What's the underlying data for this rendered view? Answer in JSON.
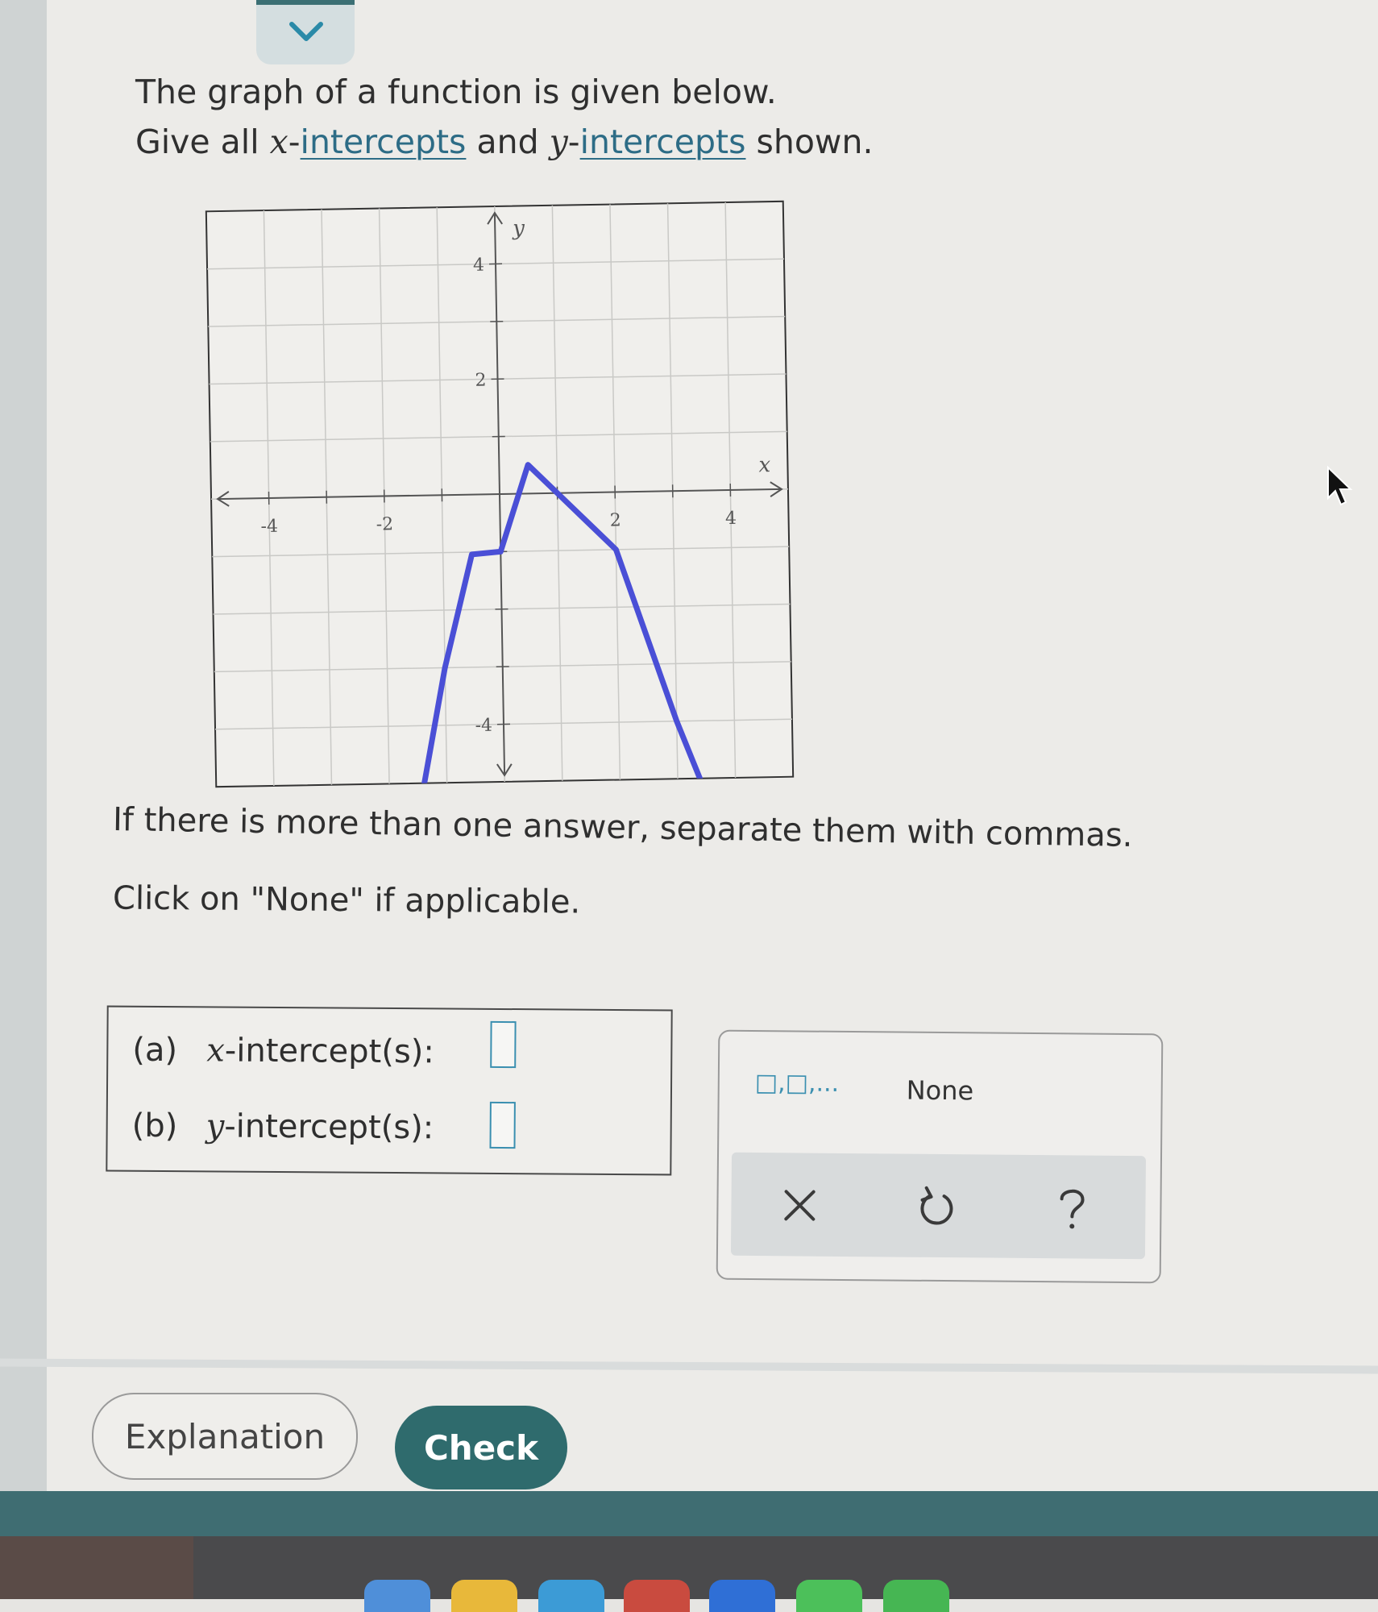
{
  "question": {
    "line1": "The graph of a function is given below.",
    "line2_prefix": "Give all ",
    "x_var": "x",
    "line2_dash1": "-",
    "x_link": "intercepts",
    "line2_mid": " and ",
    "y_var": "y",
    "line2_dash2": "-",
    "y_link": "intercepts",
    "line2_suffix": " shown."
  },
  "chart_data": {
    "type": "line",
    "title": "",
    "xlabel": "x",
    "ylabel": "y",
    "xlim": [
      -5,
      5
    ],
    "ylim": [
      -5,
      5
    ],
    "grid": true,
    "x_ticks": [
      -4,
      -2,
      2,
      4
    ],
    "y_ticks": [
      -4,
      2,
      4
    ],
    "x_tick_labels": [
      "-4",
      "-2",
      "2",
      "4"
    ],
    "y_tick_labels": [
      "-4",
      "2",
      "4"
    ],
    "series": [
      {
        "x": [
          -1.4,
          -1,
          -0.5,
          0,
          0.5,
          1,
          1.5,
          2,
          2.5,
          3,
          3.4
        ],
        "y": [
          -5.04,
          -3.0,
          -1.04,
          -1.0,
          0.5,
          0.0,
          -0.5,
          -1.0,
          -2.5,
          -4.0,
          -5.04
        ]
      }
    ],
    "line_color": "#4a4fd6"
  },
  "instructions": {
    "line1": "If there is more than one answer, separate them with commas.",
    "line2": "Click on \"None\" if applicable."
  },
  "answers": {
    "a_label": "(a)",
    "a_var": "x",
    "a_text": "-intercept(s):",
    "b_label": "(b)",
    "b_var": "y",
    "b_text": "-intercept(s):"
  },
  "keypad": {
    "multi_label": "□,□,...",
    "none_label": "None"
  },
  "buttons": {
    "explanation": "Explanation",
    "check": "Check"
  },
  "colors": {
    "accent_teal": "#2f6b6d",
    "input_blue": "#3a8fb0",
    "curve_blue": "#4a4fd6",
    "link": "#2d6c86"
  }
}
